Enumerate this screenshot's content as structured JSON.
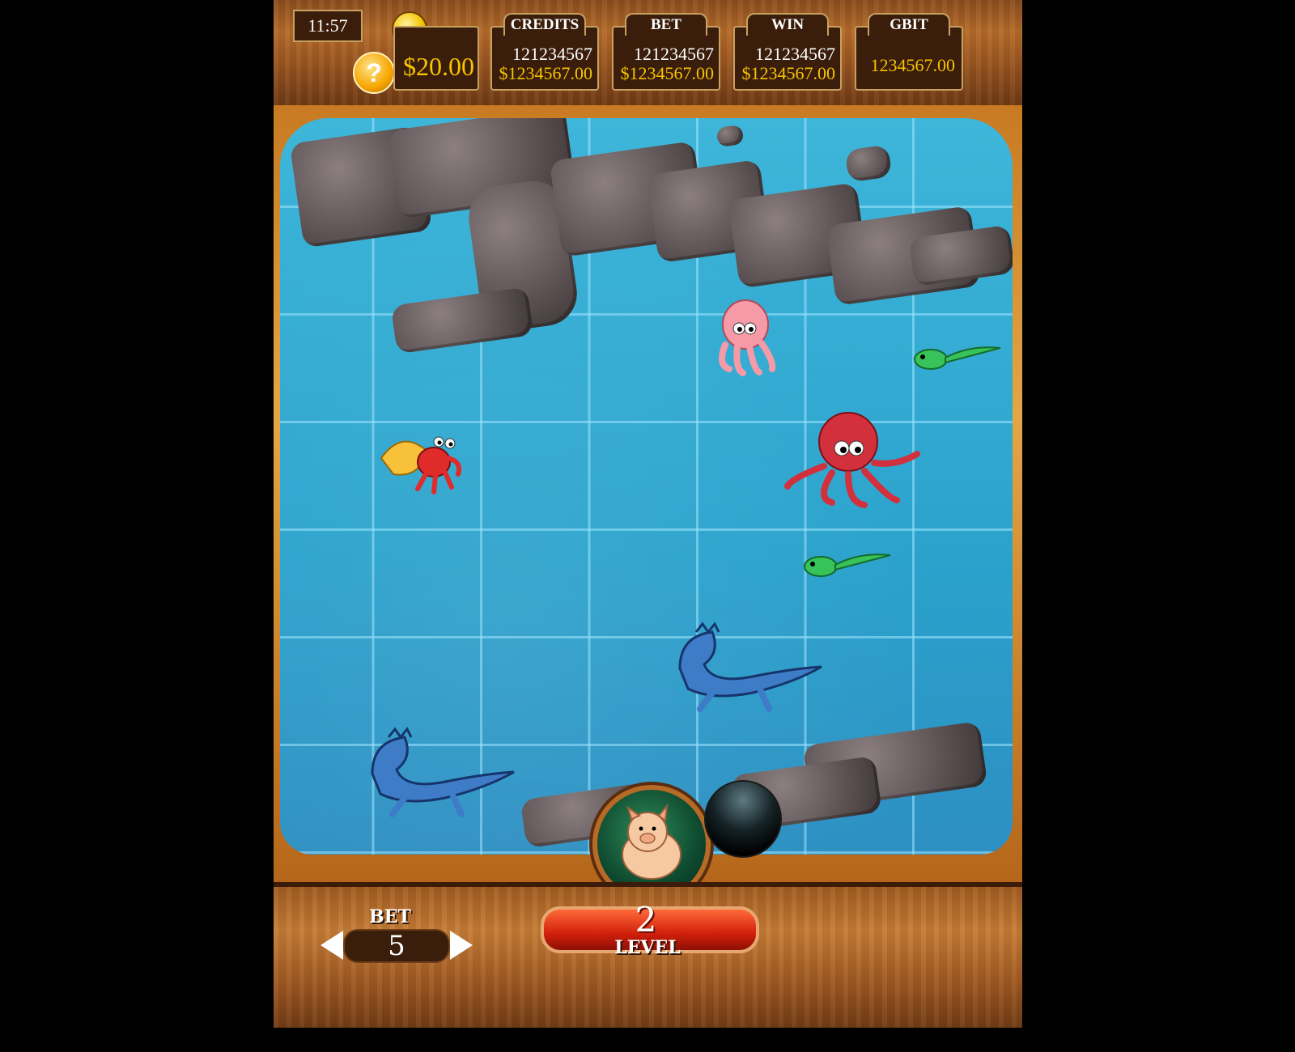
{
  "header": {
    "clock": "11:57",
    "help_label": "?",
    "balance": "$20.00",
    "panels": [
      {
        "key": "credits",
        "title": "CREDITS",
        "line1": "121234567",
        "line2": "$1234567.00"
      },
      {
        "key": "bet",
        "title": "BET",
        "line1": "121234567",
        "line2": "$1234567.00"
      },
      {
        "key": "win",
        "title": "WIN",
        "line1": "121234567",
        "line2": "$1234567.00"
      },
      {
        "key": "gbit",
        "title": "GBIT",
        "line1": "",
        "line2": "1234567.00"
      }
    ]
  },
  "footer": {
    "bet_label": "BET",
    "bet_value": "5",
    "level_value": "2",
    "level_label": "LEVEL"
  },
  "board": {
    "creatures": [
      "pink-octopus",
      "red-octopus",
      "hermit-crab",
      "green-tadpole",
      "green-tadpole",
      "blue-sea-serpent",
      "blue-sea-serpent"
    ],
    "launcher_ball": "pig-ball",
    "next_ball": "black-ball"
  },
  "colors": {
    "accent_gold": "#f7c400",
    "wood": "#b56b2a",
    "water": "#2aa2cc",
    "level_red": "#d11f0a"
  }
}
